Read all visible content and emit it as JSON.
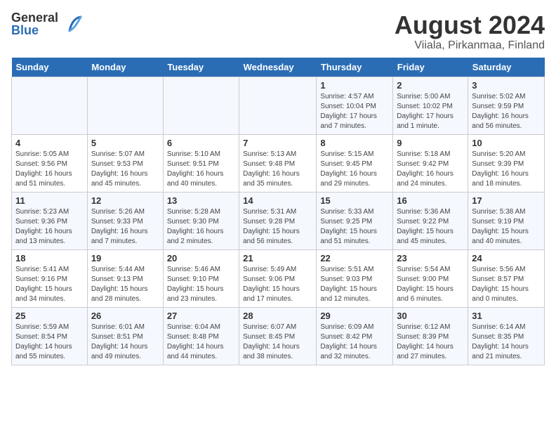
{
  "header": {
    "logo_general": "General",
    "logo_blue": "Blue",
    "title": "August 2024",
    "subtitle": "Viiala, Pirkanmaa, Finland"
  },
  "weekdays": [
    "Sunday",
    "Monday",
    "Tuesday",
    "Wednesday",
    "Thursday",
    "Friday",
    "Saturday"
  ],
  "weeks": [
    [
      {
        "day": "",
        "info": ""
      },
      {
        "day": "",
        "info": ""
      },
      {
        "day": "",
        "info": ""
      },
      {
        "day": "",
        "info": ""
      },
      {
        "day": "1",
        "info": "Sunrise: 4:57 AM\nSunset: 10:04 PM\nDaylight: 17 hours\nand 7 minutes."
      },
      {
        "day": "2",
        "info": "Sunrise: 5:00 AM\nSunset: 10:02 PM\nDaylight: 17 hours\nand 1 minute."
      },
      {
        "day": "3",
        "info": "Sunrise: 5:02 AM\nSunset: 9:59 PM\nDaylight: 16 hours\nand 56 minutes."
      }
    ],
    [
      {
        "day": "4",
        "info": "Sunrise: 5:05 AM\nSunset: 9:56 PM\nDaylight: 16 hours\nand 51 minutes."
      },
      {
        "day": "5",
        "info": "Sunrise: 5:07 AM\nSunset: 9:53 PM\nDaylight: 16 hours\nand 45 minutes."
      },
      {
        "day": "6",
        "info": "Sunrise: 5:10 AM\nSunset: 9:51 PM\nDaylight: 16 hours\nand 40 minutes."
      },
      {
        "day": "7",
        "info": "Sunrise: 5:13 AM\nSunset: 9:48 PM\nDaylight: 16 hours\nand 35 minutes."
      },
      {
        "day": "8",
        "info": "Sunrise: 5:15 AM\nSunset: 9:45 PM\nDaylight: 16 hours\nand 29 minutes."
      },
      {
        "day": "9",
        "info": "Sunrise: 5:18 AM\nSunset: 9:42 PM\nDaylight: 16 hours\nand 24 minutes."
      },
      {
        "day": "10",
        "info": "Sunrise: 5:20 AM\nSunset: 9:39 PM\nDaylight: 16 hours\nand 18 minutes."
      }
    ],
    [
      {
        "day": "11",
        "info": "Sunrise: 5:23 AM\nSunset: 9:36 PM\nDaylight: 16 hours\nand 13 minutes."
      },
      {
        "day": "12",
        "info": "Sunrise: 5:26 AM\nSunset: 9:33 PM\nDaylight: 16 hours\nand 7 minutes."
      },
      {
        "day": "13",
        "info": "Sunrise: 5:28 AM\nSunset: 9:30 PM\nDaylight: 16 hours\nand 2 minutes."
      },
      {
        "day": "14",
        "info": "Sunrise: 5:31 AM\nSunset: 9:28 PM\nDaylight: 15 hours\nand 56 minutes."
      },
      {
        "day": "15",
        "info": "Sunrise: 5:33 AM\nSunset: 9:25 PM\nDaylight: 15 hours\nand 51 minutes."
      },
      {
        "day": "16",
        "info": "Sunrise: 5:36 AM\nSunset: 9:22 PM\nDaylight: 15 hours\nand 45 minutes."
      },
      {
        "day": "17",
        "info": "Sunrise: 5:38 AM\nSunset: 9:19 PM\nDaylight: 15 hours\nand 40 minutes."
      }
    ],
    [
      {
        "day": "18",
        "info": "Sunrise: 5:41 AM\nSunset: 9:16 PM\nDaylight: 15 hours\nand 34 minutes."
      },
      {
        "day": "19",
        "info": "Sunrise: 5:44 AM\nSunset: 9:13 PM\nDaylight: 15 hours\nand 28 minutes."
      },
      {
        "day": "20",
        "info": "Sunrise: 5:46 AM\nSunset: 9:10 PM\nDaylight: 15 hours\nand 23 minutes."
      },
      {
        "day": "21",
        "info": "Sunrise: 5:49 AM\nSunset: 9:06 PM\nDaylight: 15 hours\nand 17 minutes."
      },
      {
        "day": "22",
        "info": "Sunrise: 5:51 AM\nSunset: 9:03 PM\nDaylight: 15 hours\nand 12 minutes."
      },
      {
        "day": "23",
        "info": "Sunrise: 5:54 AM\nSunset: 9:00 PM\nDaylight: 15 hours\nand 6 minutes."
      },
      {
        "day": "24",
        "info": "Sunrise: 5:56 AM\nSunset: 8:57 PM\nDaylight: 15 hours\nand 0 minutes."
      }
    ],
    [
      {
        "day": "25",
        "info": "Sunrise: 5:59 AM\nSunset: 8:54 PM\nDaylight: 14 hours\nand 55 minutes."
      },
      {
        "day": "26",
        "info": "Sunrise: 6:01 AM\nSunset: 8:51 PM\nDaylight: 14 hours\nand 49 minutes."
      },
      {
        "day": "27",
        "info": "Sunrise: 6:04 AM\nSunset: 8:48 PM\nDaylight: 14 hours\nand 44 minutes."
      },
      {
        "day": "28",
        "info": "Sunrise: 6:07 AM\nSunset: 8:45 PM\nDaylight: 14 hours\nand 38 minutes."
      },
      {
        "day": "29",
        "info": "Sunrise: 6:09 AM\nSunset: 8:42 PM\nDaylight: 14 hours\nand 32 minutes."
      },
      {
        "day": "30",
        "info": "Sunrise: 6:12 AM\nSunset: 8:39 PM\nDaylight: 14 hours\nand 27 minutes."
      },
      {
        "day": "31",
        "info": "Sunrise: 6:14 AM\nSunset: 8:35 PM\nDaylight: 14 hours\nand 21 minutes."
      }
    ]
  ]
}
